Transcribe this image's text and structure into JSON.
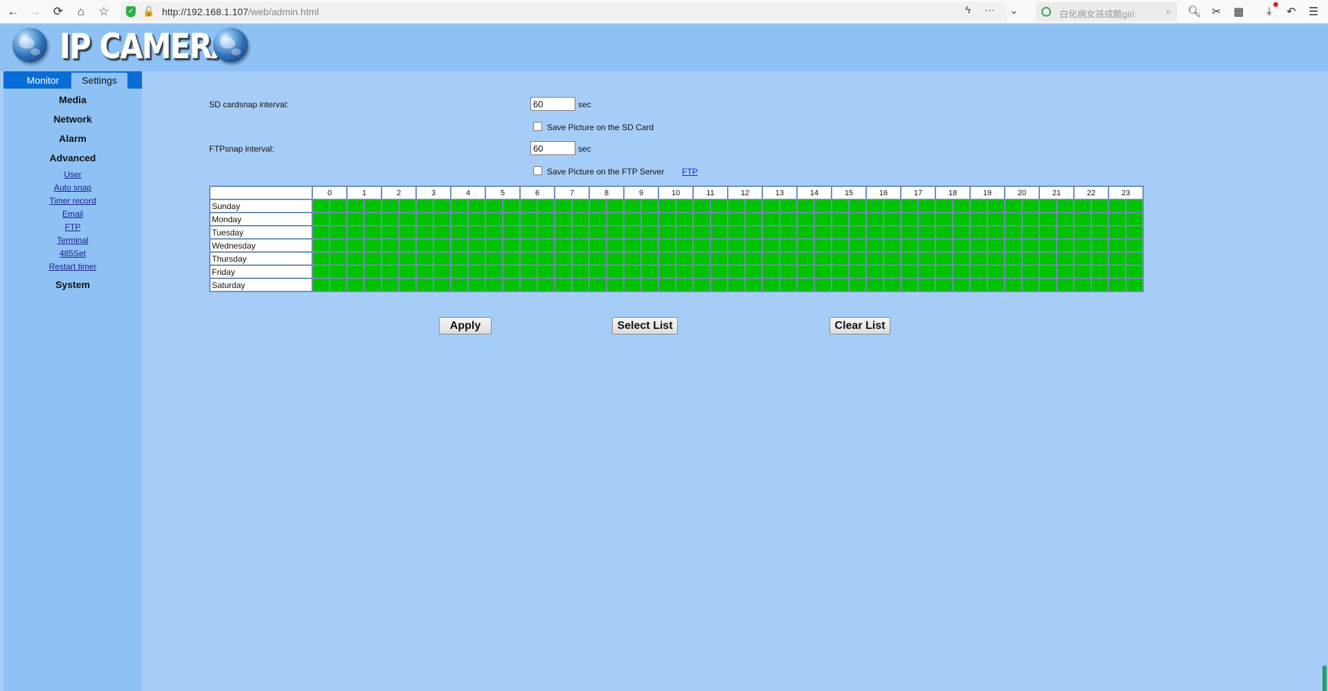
{
  "browser": {
    "url_host": "http://192.168.1.107",
    "url_path": "/web/admin.html",
    "search_placeholder": "白化病女孩成酷girl"
  },
  "app": {
    "brand": "IP CAMERA"
  },
  "tabs": {
    "monitor": "Monitor",
    "settings": "Settings"
  },
  "sidebar": {
    "media": "Media",
    "network": "Network",
    "alarm": "Alarm",
    "advanced": "Advanced",
    "links": [
      "User",
      "Auto snap",
      "Timer record",
      "Email",
      "FTP",
      "Terminal",
      "485Set",
      "Restart timer"
    ],
    "system": "System"
  },
  "form": {
    "sd_label": "SD cardsnap interval:",
    "sd_value": "60",
    "sd_unit": "sec",
    "sd_checkbox_label": "Save Picture on the SD Card",
    "ftp_label": "FTPsnap interval:",
    "ftp_value": "60",
    "ftp_unit": "sec",
    "ftp_checkbox_label": "Save Picture on the FTP Server",
    "ftp_link": "FTP"
  },
  "schedule": {
    "hours": [
      "0",
      "1",
      "2",
      "3",
      "4",
      "5",
      "6",
      "7",
      "8",
      "9",
      "10",
      "11",
      "12",
      "13",
      "14",
      "15",
      "16",
      "17",
      "18",
      "19",
      "20",
      "21",
      "22",
      "23"
    ],
    "days": [
      "Sunday",
      "Monday",
      "Tuesday",
      "Wednesday",
      "Thursday",
      "Friday",
      "Saturday"
    ],
    "cell_color": "#00c300",
    "all_selected": true
  },
  "buttons": {
    "apply": "Apply",
    "select_list": "Select List",
    "clear_list": "Clear List"
  }
}
